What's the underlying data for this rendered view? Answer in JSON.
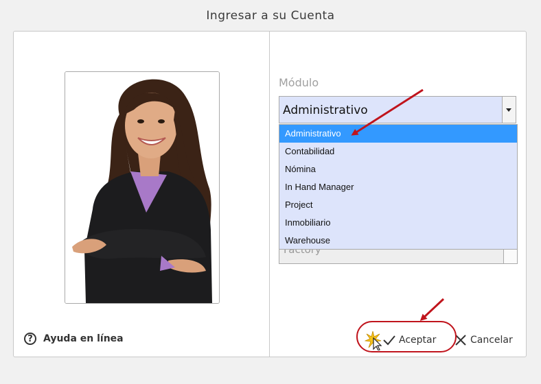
{
  "window": {
    "title": "Ingresar a su Cuenta"
  },
  "help": {
    "label": "Ayuda en línea",
    "icon": "question-circle-icon"
  },
  "module": {
    "label": "Módulo",
    "selected": "Administrativo",
    "options": [
      "Administrativo",
      "Contabilidad",
      "Nómina",
      "In Hand Manager",
      "Project",
      "Inmobiliario",
      "Warehouse"
    ]
  },
  "second_select": {
    "value": "Factory"
  },
  "actions": {
    "accept_label": "Aceptar",
    "cancel_label": "Cancelar"
  },
  "colors": {
    "highlight": "#3399ff",
    "dropdown_bg": "#dde4fb",
    "annotation": "#c0141c"
  }
}
